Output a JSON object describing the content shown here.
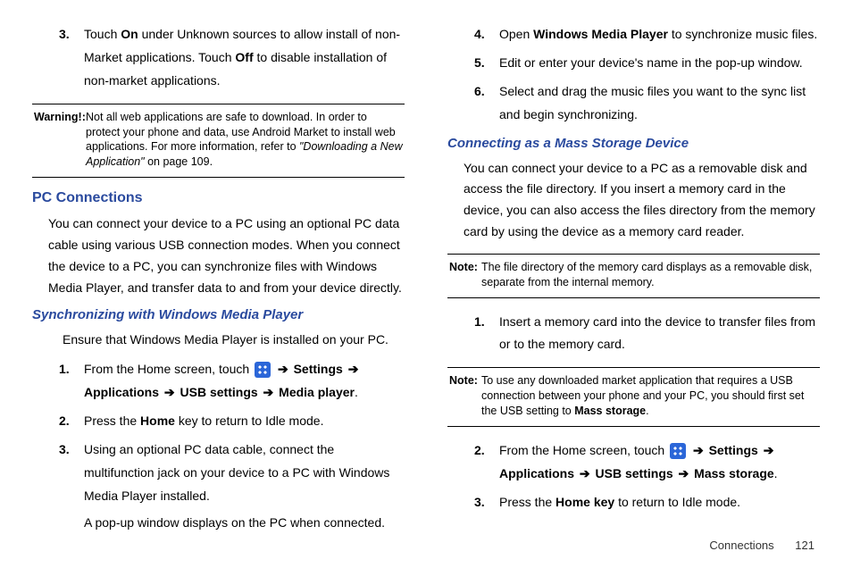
{
  "left": {
    "step3": {
      "num": "3.",
      "text_a": "Touch ",
      "text_b": "On",
      "text_c": " under Unknown sources to allow install of non-Market applications. Touch ",
      "text_d": "Off",
      "text_e": " to disable installation of non-market applications."
    },
    "warning": {
      "label": "Warning!:",
      "body_a": "Not all web applications are safe to download. In order to protect your phone and data, use Android Market to install web applications. For more information, refer to ",
      "body_b": "\"Downloading a New Application\"",
      "body_c": "  on page 109."
    },
    "h_pc": "PC Connections",
    "pc_para": "You can connect your device to a PC using an optional PC data cable using various USB connection modes. When you connect the device to a PC, you can synchronize files with Windows Media Player, and transfer data to and from your device directly.",
    "h_sync": "Synchronizing with Windows Media Player",
    "sync_para": "Ensure that Windows Media Player is installed on your PC.",
    "s1": {
      "num": "1.",
      "a": "From the Home screen, touch ",
      "arrow": "➔",
      "settings": "Settings",
      "applications": "Applications",
      "usb": "USB settings",
      "mp": "Media player",
      "period": "."
    },
    "s2": {
      "num": "2.",
      "a": "Press the ",
      "home": "Home",
      "b": " key to return to Idle mode."
    },
    "s3": {
      "num": "3.",
      "a": "Using an optional PC data cable, connect the multifunction jack on your device to a PC with Windows Media Player installed.",
      "b": "A pop-up window displays on the PC when connected."
    }
  },
  "right": {
    "s4": {
      "num": "4.",
      "a": "Open ",
      "wmp": "Windows Media Player",
      "b": " to synchronize music files."
    },
    "s5": {
      "num": "5.",
      "a": "Edit or enter your device's name in the pop-up window."
    },
    "s6": {
      "num": "6.",
      "a": "Select and drag the music files you want to the sync list and begin synchronizing."
    },
    "h_mass": "Connecting as a Mass Storage Device",
    "mass_para": "You can connect your device to a PC as a removable disk and access the file directory. If you insert a memory card in the device, you can also access the files directory from the memory card by using the device as a memory card reader.",
    "note1": {
      "label": "Note:",
      "body": "The file directory of the memory card displays as a removable disk, separate from the internal memory."
    },
    "m1": {
      "num": "1.",
      "a": "Insert a memory card into the device to transfer files from or to the memory card."
    },
    "note2": {
      "label": "Note:",
      "body_a": "To use any downloaded market application that requires a USB connection between your phone and your PC, you should first set the USB setting to ",
      "body_b": "Mass storage",
      "body_c": "."
    },
    "m2": {
      "num": "2.",
      "a": "From the Home screen, touch ",
      "arrow": "➔",
      "settings": "Settings",
      "applications": "Applications",
      "usb": "USB settings",
      "ms": "Mass storage",
      "period": "."
    },
    "m3": {
      "num": "3.",
      "a": "Press the ",
      "hk": "Home key",
      "b": " to return to Idle mode."
    }
  },
  "footer": {
    "section": "Connections",
    "page": "121"
  }
}
